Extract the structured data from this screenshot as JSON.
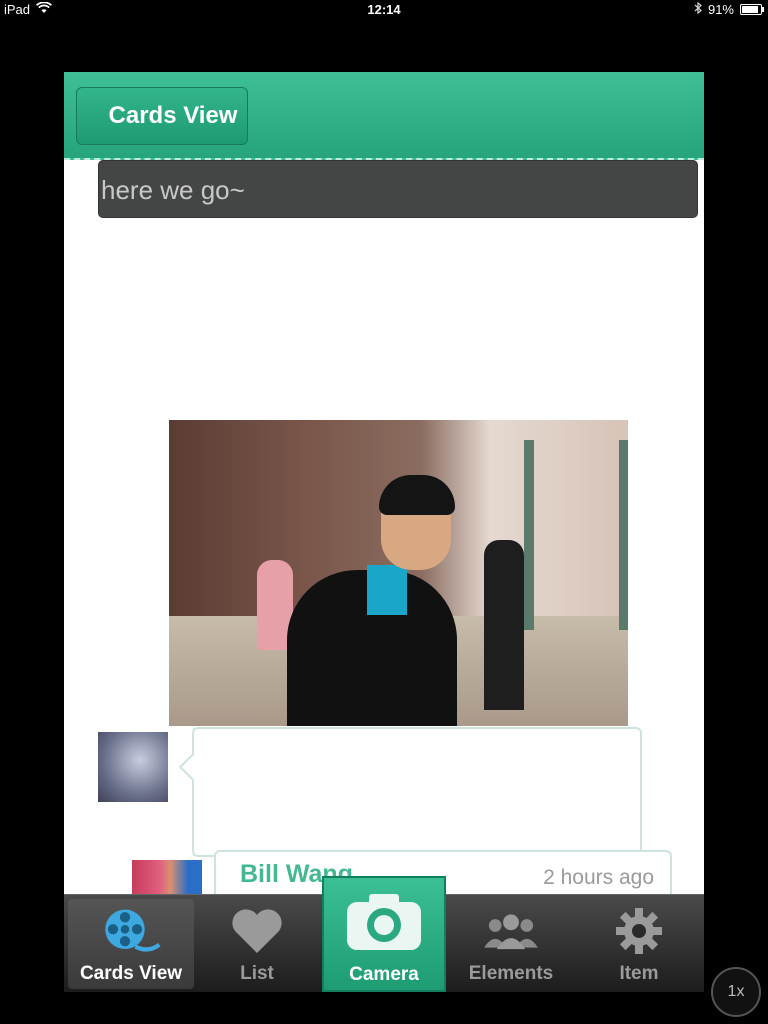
{
  "status_bar": {
    "device": "iPad",
    "time": "12:14",
    "battery": "91%"
  },
  "navbar": {
    "back_label": "Cards View"
  },
  "message_input": {
    "value": "here we go~"
  },
  "card": {
    "name": "Bill Wang",
    "time": "2 hours ago"
  },
  "tabs": [
    {
      "label": "Cards View",
      "icon": "film-reel-icon",
      "selected": true
    },
    {
      "label": "List",
      "icon": "heart-icon"
    },
    {
      "label": "Camera",
      "icon": "camera-icon"
    },
    {
      "label": "Elements",
      "icon": "people-icon"
    },
    {
      "label": "Item",
      "icon": "gear-icon"
    }
  ],
  "zoom": {
    "label": "1x"
  },
  "colors": {
    "accent": "#2aa882",
    "card_name": "#43b892"
  }
}
